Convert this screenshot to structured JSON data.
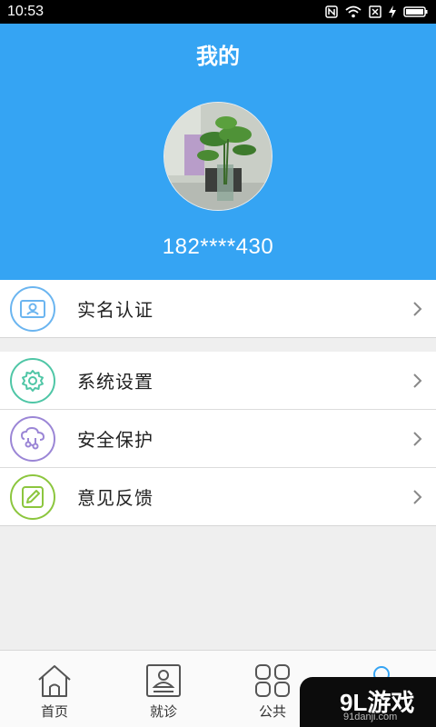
{
  "status_bar": {
    "time": "10:53"
  },
  "header": {
    "title": "我的",
    "phone": "182****430"
  },
  "menu": {
    "group1": [
      {
        "label": "实名认证",
        "icon": "id-card-icon",
        "color": "#6bb5f0"
      }
    ],
    "group2": [
      {
        "label": "系统设置",
        "icon": "gear-icon",
        "color": "#4fc6a6"
      },
      {
        "label": "安全保护",
        "icon": "shield-icon",
        "color": "#9b86d6"
      },
      {
        "label": "意见反馈",
        "icon": "feedback-icon",
        "color": "#8cc63e"
      }
    ]
  },
  "tabbar": {
    "tabs": [
      {
        "label": "首页",
        "icon": "home-icon"
      },
      {
        "label": "就诊",
        "icon": "profile-card-icon"
      },
      {
        "label": "公共",
        "icon": "grid-icon"
      },
      {
        "label": "",
        "icon": "user-icon",
        "active": true
      }
    ]
  },
  "watermark": {
    "brand": "9L游戏",
    "url": "91danji.com"
  },
  "colors": {
    "header": "#35a4f3",
    "accent": "#35a4f3"
  }
}
